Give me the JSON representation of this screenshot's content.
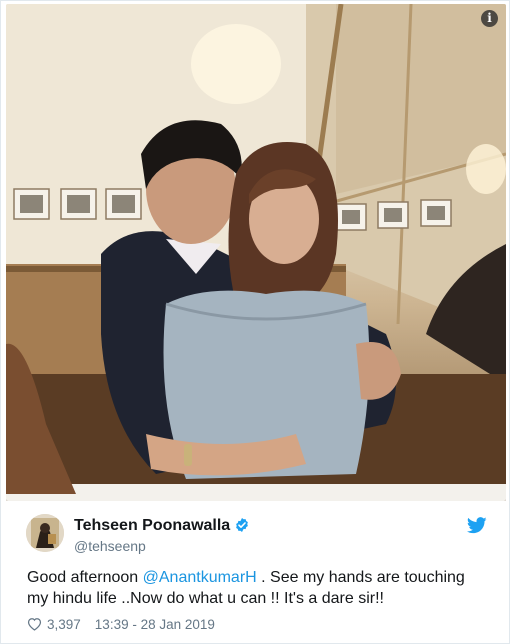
{
  "author": {
    "name": "Tehseen Poonawalla",
    "handle": "@tehseenp"
  },
  "tweet": {
    "text_before": "Good afternoon ",
    "mention": "@AnantkumarH",
    "text_after": " . See my hands are touching my hindu life ..Now do what u can !! It's a dare sir!!"
  },
  "footer": {
    "likes": "3,397",
    "timestamp": "13:39 - 28 Jan 2019"
  },
  "icons": {
    "info": "i",
    "verified": "verified-badge",
    "brand": "twitter-bird",
    "like": "heart-outline"
  },
  "colors": {
    "link": "#1b95e0",
    "secondary_text": "#657786",
    "verified": "#1da1f2",
    "brand": "#1da1f2"
  }
}
